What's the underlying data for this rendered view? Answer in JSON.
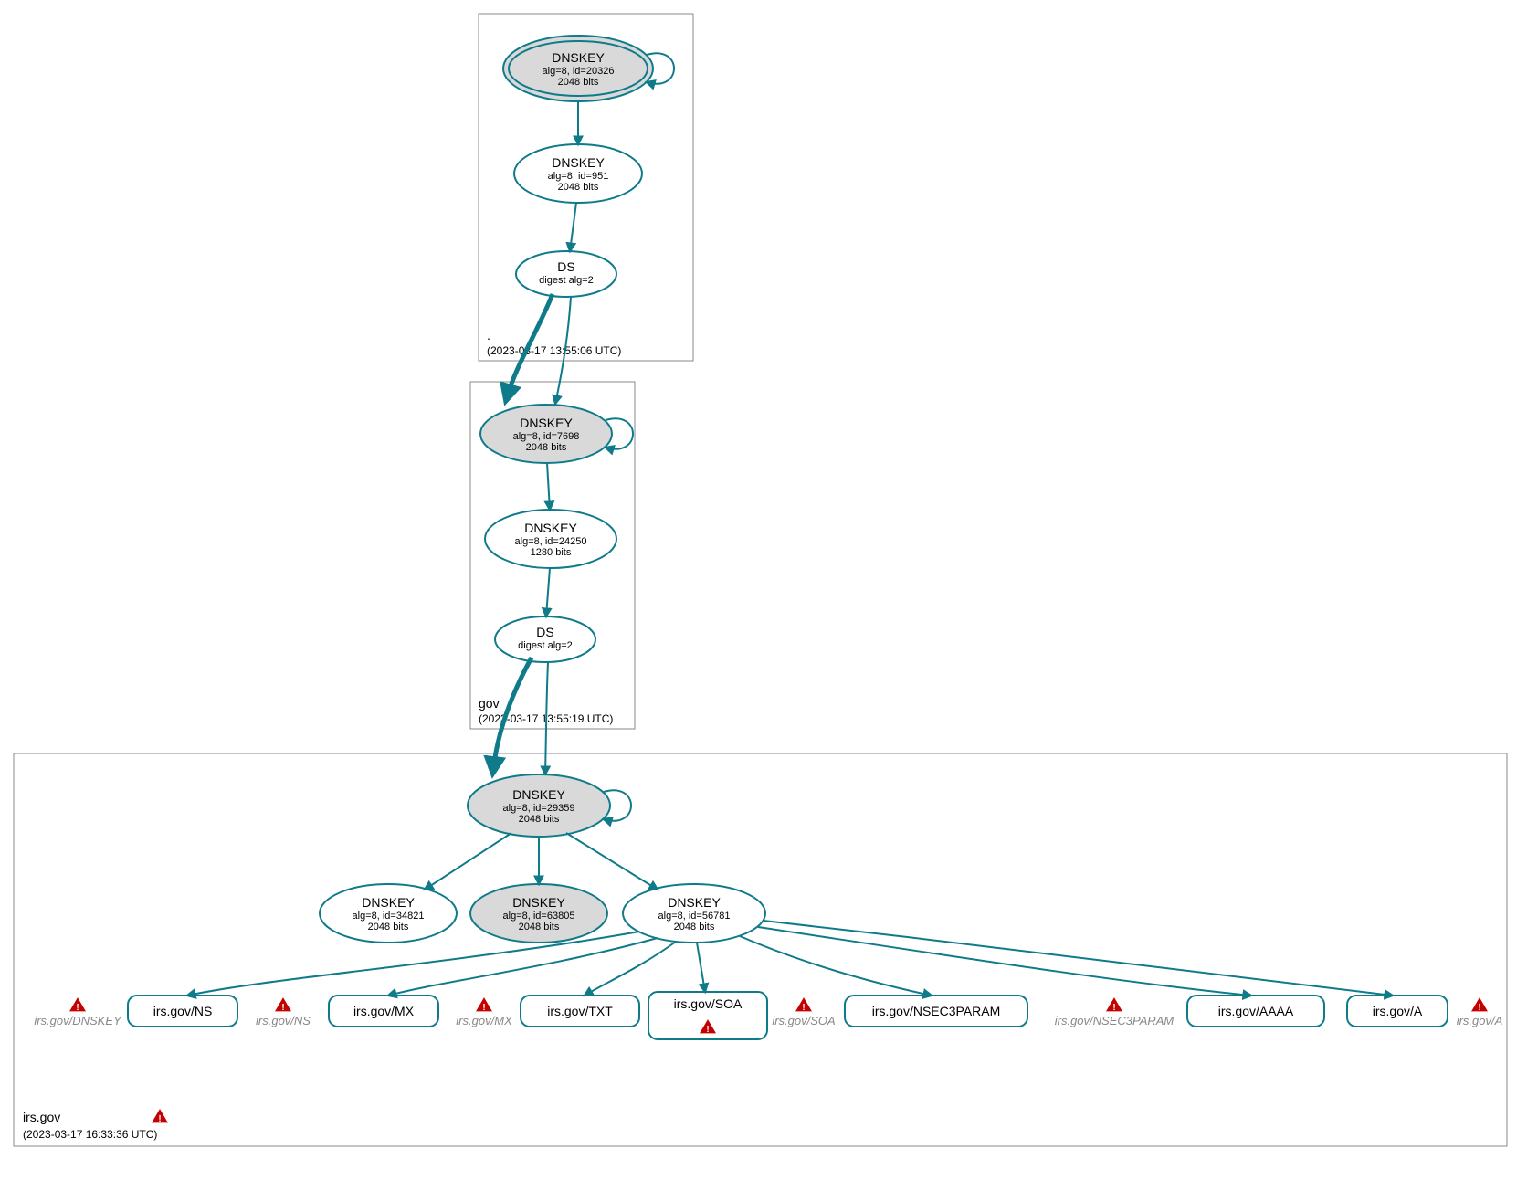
{
  "colors": {
    "teal": "#0f7b8a",
    "kskFill": "#d9d9d9",
    "warn": "#c40000",
    "ghost": "#888888"
  },
  "zones": {
    "root": {
      "label": ".",
      "timestamp": "(2023-03-17 13:55:06 UTC)",
      "nodes": {
        "ksk": {
          "title": "DNSKEY",
          "sub1": "alg=8, id=20326",
          "sub2": "2048 bits"
        },
        "zsk": {
          "title": "DNSKEY",
          "sub1": "alg=8, id=951",
          "sub2": "2048 bits"
        },
        "ds": {
          "title": "DS",
          "sub1": "digest alg=2"
        }
      }
    },
    "gov": {
      "label": "gov",
      "timestamp": "(2023-03-17 13:55:19 UTC)",
      "nodes": {
        "ksk": {
          "title": "DNSKEY",
          "sub1": "alg=8, id=7698",
          "sub2": "2048 bits"
        },
        "zsk": {
          "title": "DNSKEY",
          "sub1": "alg=8, id=24250",
          "sub2": "1280 bits"
        },
        "ds": {
          "title": "DS",
          "sub1": "digest alg=2"
        }
      }
    },
    "irs": {
      "label": "irs.gov",
      "timestamp": "(2023-03-17 16:33:36 UTC)",
      "nodes": {
        "ksk": {
          "title": "DNSKEY",
          "sub1": "alg=8, id=29359",
          "sub2": "2048 bits"
        },
        "zsk1": {
          "title": "DNSKEY",
          "sub1": "alg=8, id=34821",
          "sub2": "2048 bits"
        },
        "zsk2": {
          "title": "DNSKEY",
          "sub1": "alg=8, id=63805",
          "sub2": "2048 bits"
        },
        "zsk3": {
          "title": "DNSKEY",
          "sub1": "alg=8, id=56781",
          "sub2": "2048 bits"
        }
      },
      "leaves": {
        "ns": "irs.gov/NS",
        "mx": "irs.gov/MX",
        "txt": "irs.gov/TXT",
        "soa": "irs.gov/SOA",
        "nsec3": "irs.gov/NSEC3PARAM",
        "aaaa": "irs.gov/AAAA",
        "a": "irs.gov/A"
      },
      "ghosts": {
        "dnskey": "irs.gov/DNSKEY",
        "ns": "irs.gov/NS",
        "mx": "irs.gov/MX",
        "soa": "irs.gov/SOA",
        "nsec3": "irs.gov/NSEC3PARAM",
        "a": "irs.gov/A"
      }
    }
  }
}
